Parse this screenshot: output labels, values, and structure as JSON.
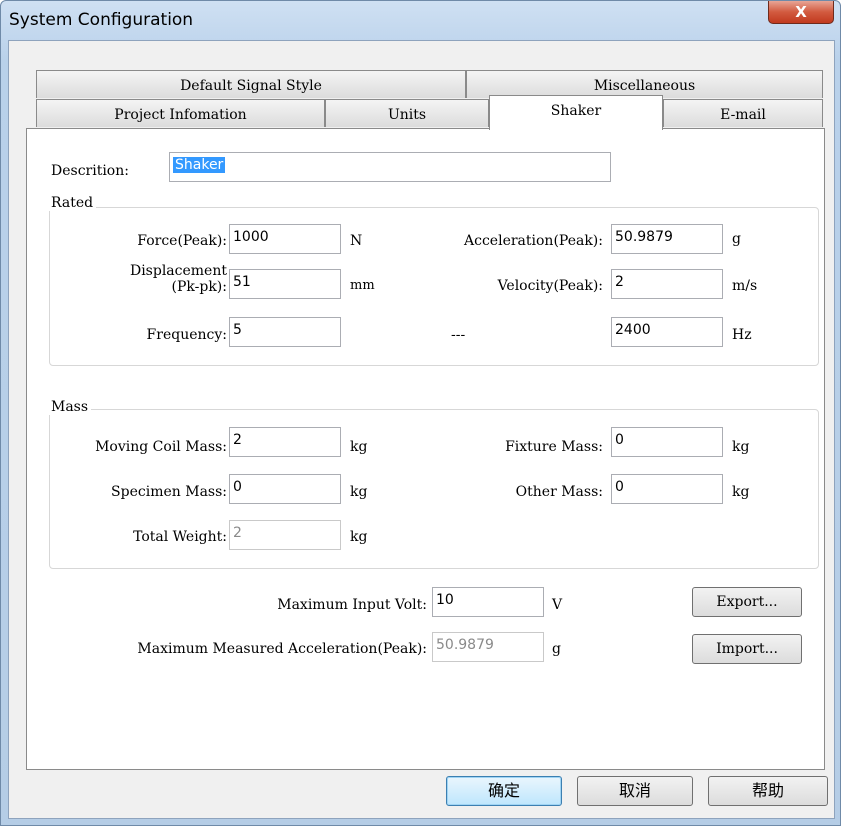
{
  "window": {
    "title": "System Configuration",
    "close_symbol": "X"
  },
  "tabs_row1": [
    {
      "label": "Default Signal Style"
    },
    {
      "label": "Miscellaneous"
    }
  ],
  "tabs_row2": [
    {
      "label": "Project Infomation"
    },
    {
      "label": "Units"
    },
    {
      "label": "Shaker",
      "active": true
    },
    {
      "label": "E-mail"
    }
  ],
  "description": {
    "label": "Descrition:",
    "value": "Shaker"
  },
  "rated": {
    "title": "Rated",
    "force_label": "Force(Peak):",
    "force_value": "1000",
    "force_unit": "N",
    "accel_label": "Acceleration(Peak):",
    "accel_value": "50.9879",
    "accel_unit": "g",
    "disp_label_1": "Displacement",
    "disp_label_2": "(Pk-pk):",
    "disp_value": "51",
    "disp_unit": "mm",
    "vel_label": "Velocity(Peak):",
    "vel_value": "2",
    "vel_unit": "m/s",
    "freq_label": "Frequency:",
    "freq_value": "5",
    "dash_label": "---",
    "dash_value": "2400",
    "dash_unit": "Hz"
  },
  "mass": {
    "title": "Mass",
    "coil_label": "Moving Coil Mass:",
    "coil_value": "2",
    "coil_unit": "kg",
    "fixture_label": "Fixture Mass:",
    "fixture_value": "0",
    "fixture_unit": "kg",
    "specimen_label": "Specimen Mass:",
    "specimen_value": "0",
    "specimen_unit": "kg",
    "other_label": "Other Mass:",
    "other_value": "0",
    "other_unit": "kg",
    "total_label": "Total Weight:",
    "total_value": "2",
    "total_unit": "kg"
  },
  "limits": {
    "max_volt_label": "Maximum Input Volt:",
    "max_volt_value": "10",
    "max_volt_unit": "V",
    "max_accel_label": "Maximum Measured Acceleration(Peak):",
    "max_accel_value": "50.9879",
    "max_accel_unit": "g",
    "export_label": "Export...",
    "import_label": "Import..."
  },
  "footer": {
    "ok_label": "确定",
    "cancel_label": "取消",
    "help_label": "帮助"
  }
}
